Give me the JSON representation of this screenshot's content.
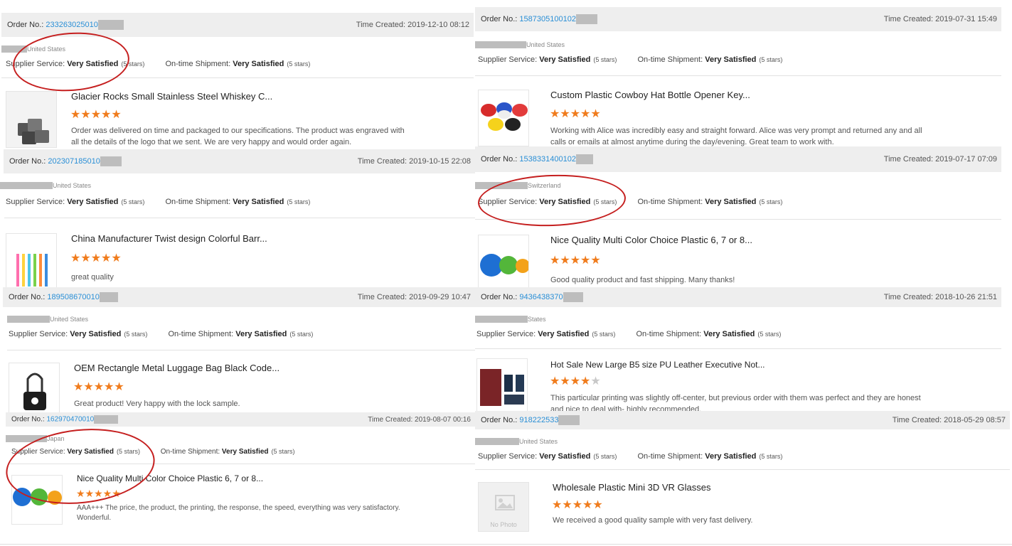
{
  "labels": {
    "order_no": "Order No.:",
    "time_created": "Time Created:",
    "supplier_service": "Supplier Service:",
    "on_time_shipment": "On-time Shipment:",
    "very_satisfied": "Very Satisfied",
    "five_stars": "(5 stars)",
    "no_photo": "No Photo"
  },
  "colors": {
    "link": "#2a8fd6",
    "star": "#f07c1d",
    "highlight_circle": "#c51f1f",
    "header_bg": "#eeeeee"
  },
  "orders": [
    {
      "order_no": "233263025010",
      "time": "2019-12-10 08:12",
      "location": "United States",
      "product": "Glacier Rocks Small Stainless Steel Whiskey C...",
      "rating": 5,
      "review": "Order was delivered on time and packaged to our specifications. The product was engraved with all the details of the logo that we sent. We are very happy and would order again.",
      "image_icon": "whiskey-stones-image"
    },
    {
      "order_no": "202307185010",
      "time": "2019-10-15 22:08",
      "location": "United States",
      "product": "China Manufacturer Twist design Colorful Barr...",
      "rating": 5,
      "review": "great quality",
      "image_icon": "colorful-pens-image"
    },
    {
      "order_no": "189508670010",
      "time": "2019-09-29 10:47",
      "location": "United States",
      "product": "OEM Rectangle Metal Luggage Bag Black Code...",
      "rating": 5,
      "review": "Great product! Very happy with the lock sample.",
      "image_icon": "luggage-lock-image"
    },
    {
      "order_no": "162970470010",
      "time": "2019-08-07 00:16",
      "location": "Japan",
      "product": "Nice Quality Multi Color Choice Plastic 6, 7 or 8...",
      "rating": 5,
      "review": "AAA+++ The price, the product, the printing, the response, the speed, everything was very satisfactory. Wonderful.",
      "image_icon": "color-frisbees-image"
    },
    {
      "order_no": "1587305100102",
      "time": "2019-07-31 15:49",
      "location": "United States",
      "product": "Custom Plastic Cowboy Hat Bottle Opener Key...",
      "rating": 5,
      "review": "Working with Alice was incredibly easy and straight forward. Alice was very prompt and returned any and all calls or emails at almost anytime during the day/evening. Great team to work with.",
      "image_icon": "hat-bottle-opener-image"
    },
    {
      "order_no": "1538331400102",
      "time": "2019-07-17 07:09",
      "location": "Switzerland",
      "product": "Nice Quality Multi Color Choice Plastic 6, 7 or 8...",
      "rating": 5,
      "review": "Good quality product and fast shipping. Many thanks!",
      "image_icon": "color-frisbees-image"
    },
    {
      "order_no": "9436438370",
      "time": "2018-10-26 21:51",
      "location": "States",
      "product": "Hot Sale New Large B5 size PU Leather Executive Not...",
      "rating": 4,
      "review": "This particular printing was slightly off-center, but previous order with them was perfect and they are honest and nice to deal with- highly recommended.",
      "image_icon": "leather-notebook-image"
    },
    {
      "order_no": "918222533",
      "time": "2018-05-29 08:57",
      "location": "United States",
      "product": "Wholesale Plastic Mini 3D VR Glasses",
      "rating": 5,
      "review": "We received a good quality sample with very fast delivery.",
      "image_icon": "no-photo-image"
    }
  ]
}
